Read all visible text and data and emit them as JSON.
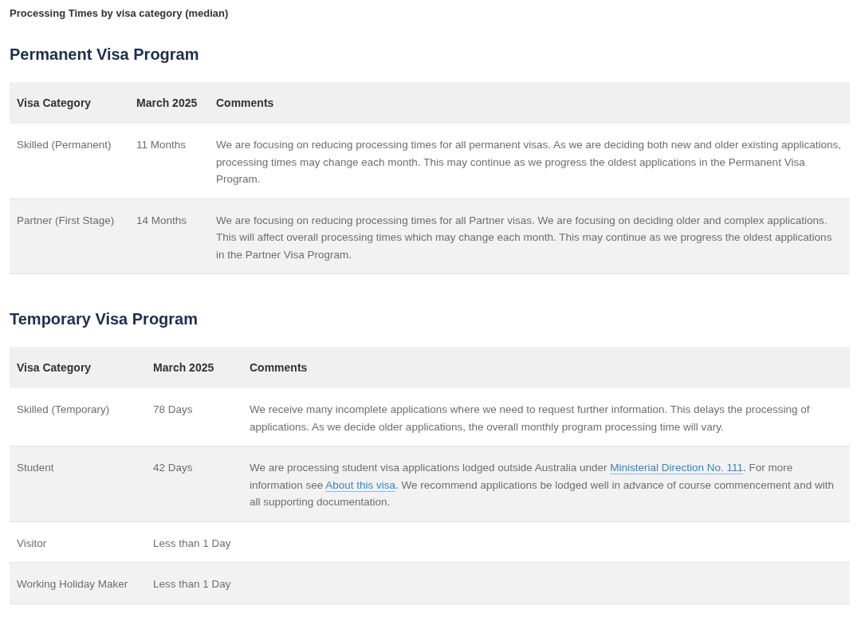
{
  "caption": "Processing Times by visa category (median)",
  "sections": [
    {
      "heading": "Permanent Visa Program",
      "columns": [
        "Visa Category",
        "March 2025",
        "Comments"
      ],
      "rows": [
        {
          "category": "Skilled (Permanent)",
          "time": "11 Months",
          "comments": [
            {
              "kind": "text",
              "text": "We are focusing on reducing processing times for all permanent visas. As we are deciding both new and older existing applications, processing times may change each month. This may continue as we progress the oldest applications in the Permanent Visa Program."
            }
          ]
        },
        {
          "category": "Partner (First Stage)",
          "time": "14 Months",
          "comments": [
            {
              "kind": "text",
              "text": "We are focusing on reducing processing times for all Partner visas. We are focusing on deciding older and complex applications. This will affect overall processing times which may change each month. This may continue as we progress the oldest applications in the Partner Visa Program."
            }
          ]
        }
      ]
    },
    {
      "heading": "Temporary Visa Program",
      "columns": [
        "Visa Category",
        "March 2025",
        "Comments"
      ],
      "rows": [
        {
          "category": "Skilled (Temporary)",
          "time": "78 Days",
          "comments": [
            {
              "kind": "text",
              "text": "We receive many incomplete applications where we need to request further information. This delays the processing of applications. As we decide older applications, the overall monthly program processing time will vary."
            }
          ]
        },
        {
          "category": "Student",
          "time": "42 Days",
          "comments": [
            {
              "kind": "text",
              "text": "We are processing student visa applications lodged outside Australia under "
            },
            {
              "kind": "link",
              "text": "Ministerial Direction No. 111"
            },
            {
              "kind": "text",
              "text": ". For more information see "
            },
            {
              "kind": "link",
              "text": "About this visa"
            },
            {
              "kind": "text",
              "text": ". We recommend applications be lodged well in advance of course commencement and with all supporting documentation."
            }
          ]
        },
        {
          "category": "Visitor",
          "time": "Less than 1 Day"
        },
        {
          "category": "Working Holiday Maker",
          "time": "Less than 1 Day"
        }
      ]
    }
  ]
}
